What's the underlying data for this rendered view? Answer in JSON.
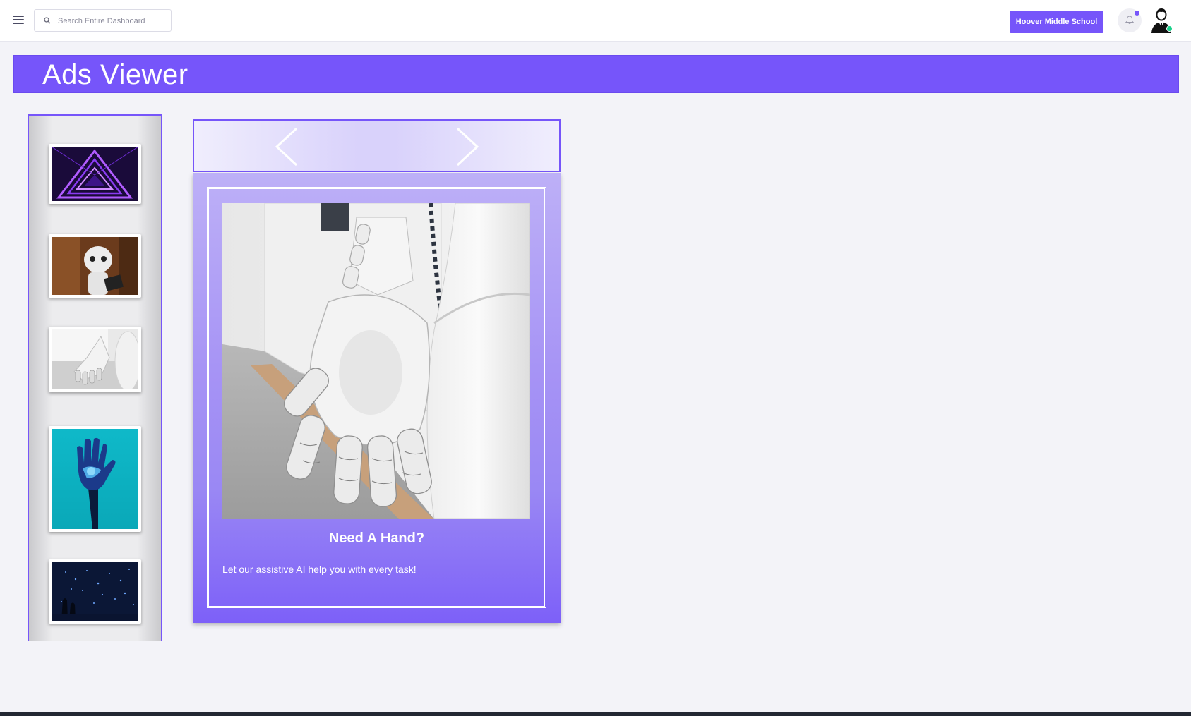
{
  "topbar": {
    "search_placeholder": "Search Entire Dashboard",
    "school_button": "Hoover Middle School",
    "icons": [
      "menu-icon",
      "search-icon",
      "bell-icon",
      "avatar"
    ]
  },
  "banner": {
    "title": "Ads Viewer"
  },
  "thumbnails": [
    {
      "name": "neon-triangle"
    },
    {
      "name": "pepper-robot"
    },
    {
      "name": "robot-hand"
    },
    {
      "name": "blue-glowing-hand"
    },
    {
      "name": "dark-city-lights"
    }
  ],
  "viewer": {
    "prev_icon": "chevron-left-icon",
    "next_icon": "chevron-right-icon",
    "ad": {
      "title": "Need A Hand?",
      "description": "Let our assistive AI help you with every task!"
    }
  },
  "colors": {
    "accent": "#7655fa",
    "status_online": "#1ad18b"
  }
}
